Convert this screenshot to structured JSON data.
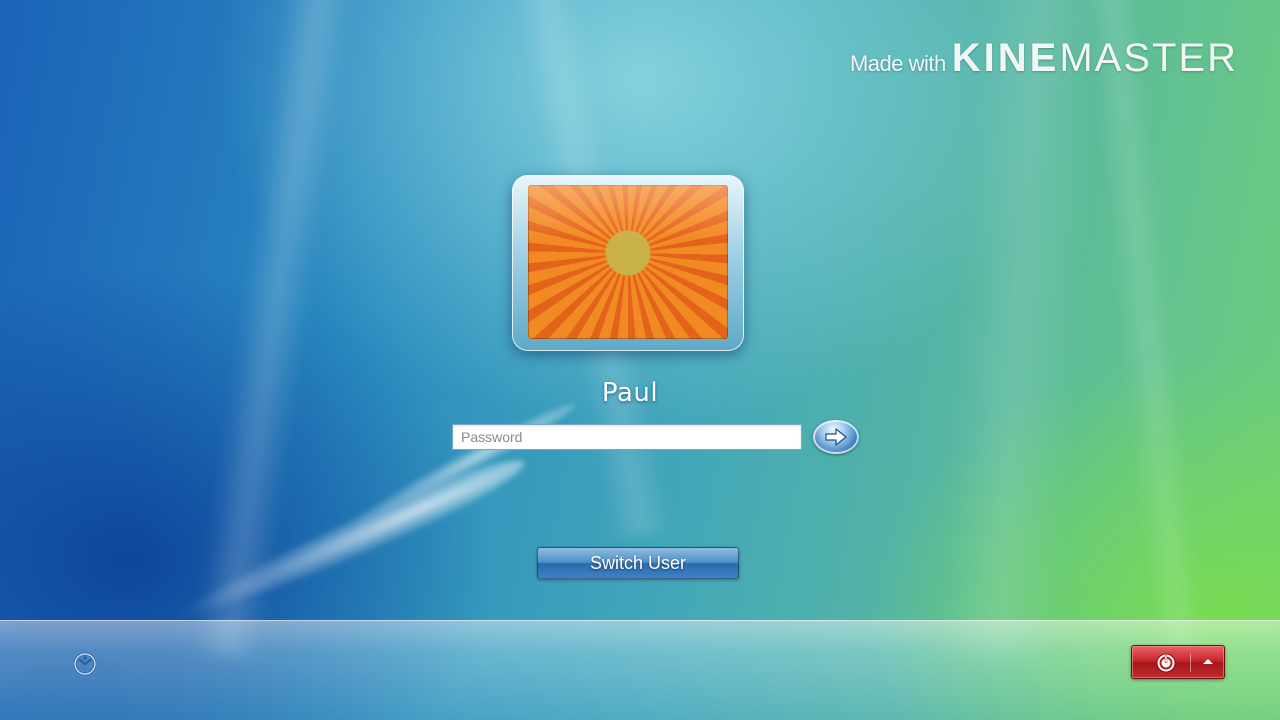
{
  "watermark": {
    "made_with": "Made with",
    "brand_bold": "KINE",
    "brand_light": "MASTER"
  },
  "login": {
    "username": "Paul",
    "password_placeholder": "Password",
    "submit_icon": "arrow-right-icon",
    "switch_user_label": "Switch User"
  },
  "bottom_bar": {
    "ease_of_access_icon": "ease-of-access-icon",
    "power_icon": "power-icon",
    "power_menu_icon": "chevron-up-icon"
  },
  "colors": {
    "power_red": "#c62428",
    "button_blue": "#3c82c4"
  }
}
